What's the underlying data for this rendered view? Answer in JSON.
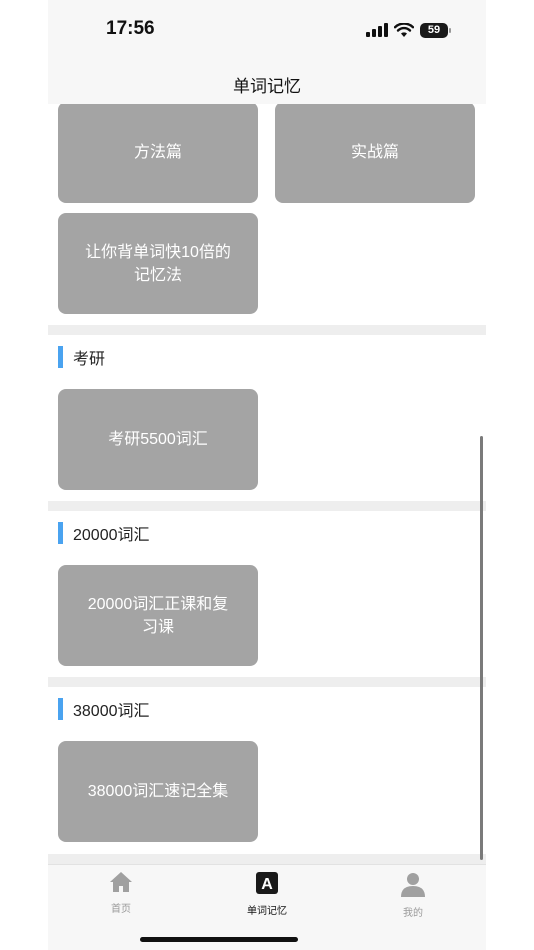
{
  "status_bar": {
    "time": "17:56",
    "battery": "59"
  },
  "header": {
    "title": "单词记忆"
  },
  "tiles_top": [
    "方法篇",
    "实战篇",
    "让你背单词快10倍的记忆法"
  ],
  "sections": [
    {
      "title": "考研",
      "tiles": [
        "考研5500词汇"
      ]
    },
    {
      "title": "20000词汇",
      "tiles": [
        "20000词汇正课和复习课"
      ]
    },
    {
      "title": "38000词汇",
      "tiles": [
        "38000词汇速记全集"
      ]
    }
  ],
  "tabbar": {
    "items": [
      {
        "label": "首页",
        "icon": "home-icon"
      },
      {
        "label": "单词记忆",
        "icon": "letter-a-icon"
      },
      {
        "label": "我的",
        "icon": "person-icon"
      }
    ],
    "active_index": 1,
    "active_color": "#111111",
    "inactive_color": "#9a9a9a"
  },
  "colors": {
    "accent": "#4aa3f0",
    "tile": "#a4a4a4"
  }
}
